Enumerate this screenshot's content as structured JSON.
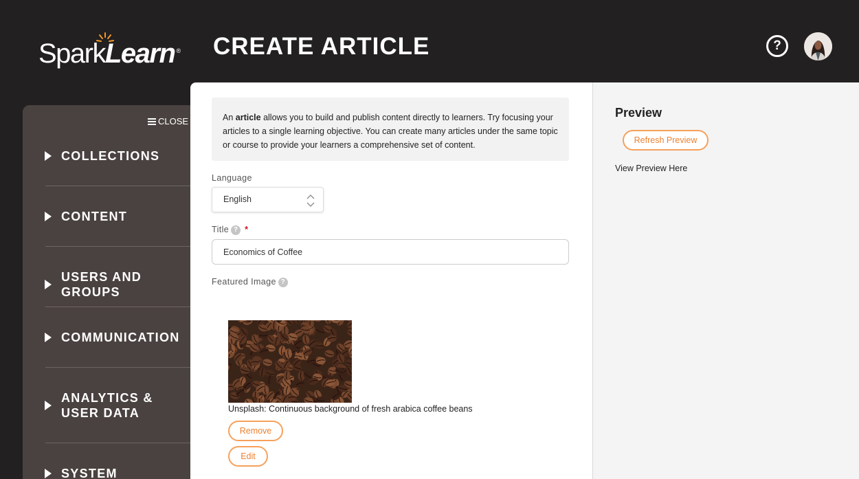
{
  "header": {
    "logo_spark": "Spark",
    "logo_learn": "Learn",
    "logo_reg": "®",
    "title": "CREATE ARTICLE",
    "help_glyph": "?"
  },
  "sidebar": {
    "close_label": "CLOSE",
    "items": [
      {
        "label": "COLLECTIONS"
      },
      {
        "label": "CONTENT"
      },
      {
        "label": "USERS AND GROUPS"
      },
      {
        "label": "COMMUNICATION"
      },
      {
        "label": "ANALYTICS & USER DATA"
      },
      {
        "label": "SYSTEM"
      }
    ]
  },
  "form": {
    "intro_prefix": "An ",
    "intro_bold": "article",
    "intro_rest": " allows you to build and publish content directly to learners. Try focusing your articles to a single learning objective. You can create many articles under the same topic or course to provide your learners a comprehensive set of content.",
    "language_label": "Language",
    "language_value": "English",
    "title_label": "Title",
    "required_mark": "*",
    "title_value": "Economics of Coffee",
    "featured_image_label": "Featured Image",
    "help_glyph": "?",
    "image_caption": "Unsplash: Continuous background of fresh arabica coffee beans",
    "remove_label": "Remove",
    "edit_label": "Edit"
  },
  "preview": {
    "title": "Preview",
    "refresh_label": "Refresh Preview",
    "note": "View Preview Here"
  },
  "colors": {
    "accent": "#ee8130",
    "header_bg": "#222021",
    "sidebar_bg": "#4a4240",
    "preview_bg": "#f4f4f4"
  }
}
